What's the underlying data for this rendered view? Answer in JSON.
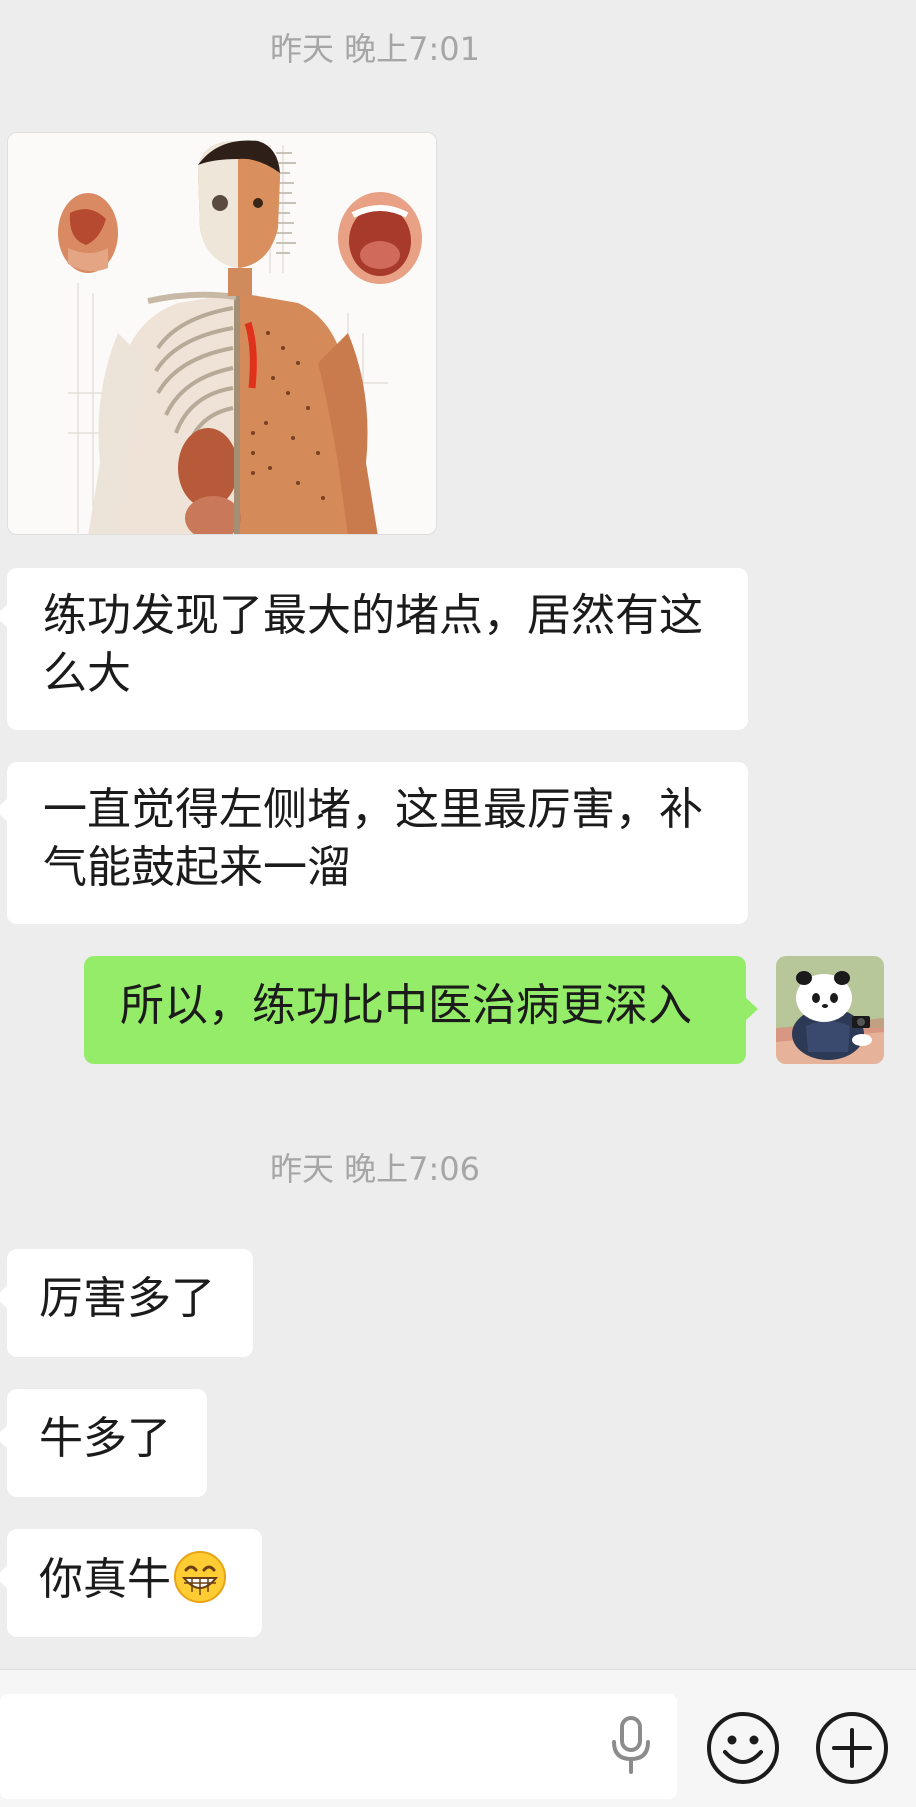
{
  "conversation": {
    "timestamp_1": "昨天 晚上7:01",
    "timestamp_2": "昨天 晚上7:06",
    "messages": [
      {
        "from": "other",
        "type": "image",
        "description_icon": "acupuncture-body-chart-image"
      },
      {
        "from": "other",
        "type": "text",
        "text": "练功发现了最大的堵点，居然有这么大"
      },
      {
        "from": "other",
        "type": "text",
        "text": "一直觉得左侧堵，这里最厉害，补气能鼓起来一溜"
      },
      {
        "from": "me",
        "type": "text",
        "text": "所以，练功比中医治病更深入"
      },
      {
        "from": "other",
        "type": "text",
        "text": "厉害多了"
      },
      {
        "from": "other",
        "type": "text",
        "text": "牛多了"
      },
      {
        "from": "other",
        "type": "text",
        "text": "你真牛",
        "emoji": "grin-emoji"
      }
    ]
  },
  "input_bar": {
    "icons": [
      "microphone-icon",
      "smiley-icon",
      "plus-icon"
    ]
  },
  "colors": {
    "background": "#ededed",
    "incoming_bubble": "#ffffff",
    "outgoing_bubble": "#95ec69",
    "timestamp": "#a6a6a6"
  }
}
